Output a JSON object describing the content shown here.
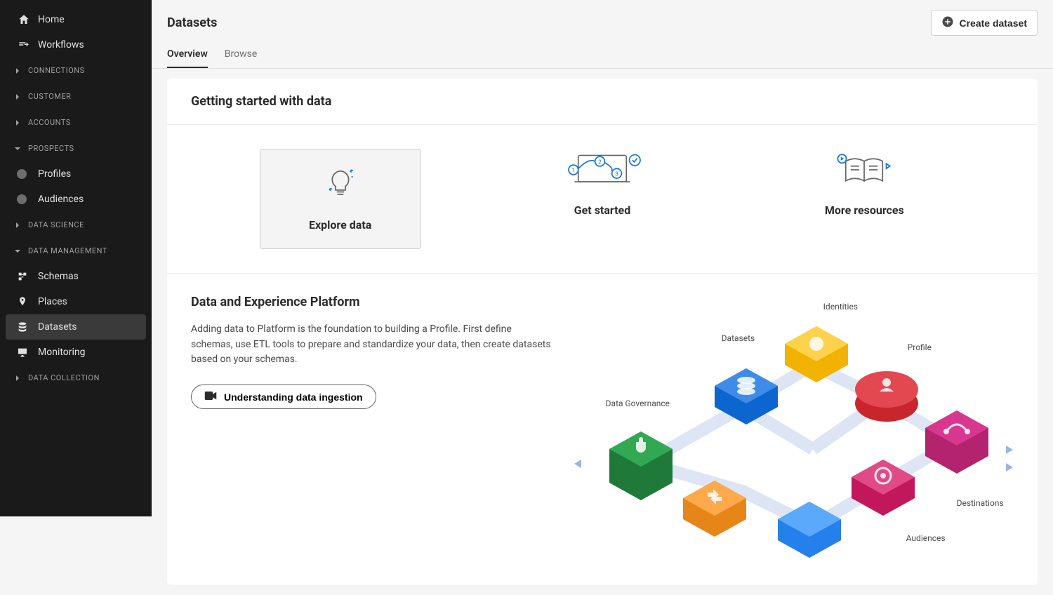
{
  "sidebar": {
    "top": [
      {
        "label": "Home",
        "icon": "home-icon"
      },
      {
        "label": "Workflows",
        "icon": "workflows-icon"
      }
    ],
    "sections": [
      {
        "label": "CONNECTIONS",
        "expanded": false
      },
      {
        "label": "CUSTOMER",
        "expanded": false
      },
      {
        "label": "ACCOUNTS",
        "expanded": false
      },
      {
        "label": "PROSPECTS",
        "expanded": true,
        "items": [
          {
            "label": "Profiles"
          },
          {
            "label": "Audiences"
          }
        ]
      },
      {
        "label": "DATA SCIENCE",
        "expanded": false
      },
      {
        "label": "DATA MANAGEMENT",
        "expanded": true,
        "items": [
          {
            "label": "Schemas",
            "icon": "schema-icon"
          },
          {
            "label": "Places",
            "icon": "pin-icon"
          },
          {
            "label": "Datasets",
            "icon": "database-icon",
            "active": true
          },
          {
            "label": "Monitoring",
            "icon": "monitor-icon"
          }
        ]
      },
      {
        "label": "DATA COLLECTION",
        "expanded": false
      }
    ]
  },
  "header": {
    "title": "Datasets",
    "create_button": "Create dataset"
  },
  "tabs": [
    {
      "label": "Overview",
      "active": true
    },
    {
      "label": "Browse",
      "active": false
    }
  ],
  "panel": {
    "title": "Getting started with data",
    "cards": [
      {
        "title": "Explore data",
        "active": true
      },
      {
        "title": "Get started",
        "active": false
      },
      {
        "title": "More resources",
        "active": false
      }
    ],
    "section": {
      "heading": "Data and Experience Platform",
      "body": "Adding data to Platform is the foundation to building a Profile. First define schemas, use ETL tools to prepare and standardize your data, then create datasets based on your schemas.",
      "button": "Understanding data ingestion"
    },
    "diagram_labels": {
      "identities": "Identities",
      "datasets": "Datasets",
      "profile": "Profile",
      "governance": "Data Governance",
      "destinations": "Destinations",
      "audiences": "Audiences"
    }
  }
}
